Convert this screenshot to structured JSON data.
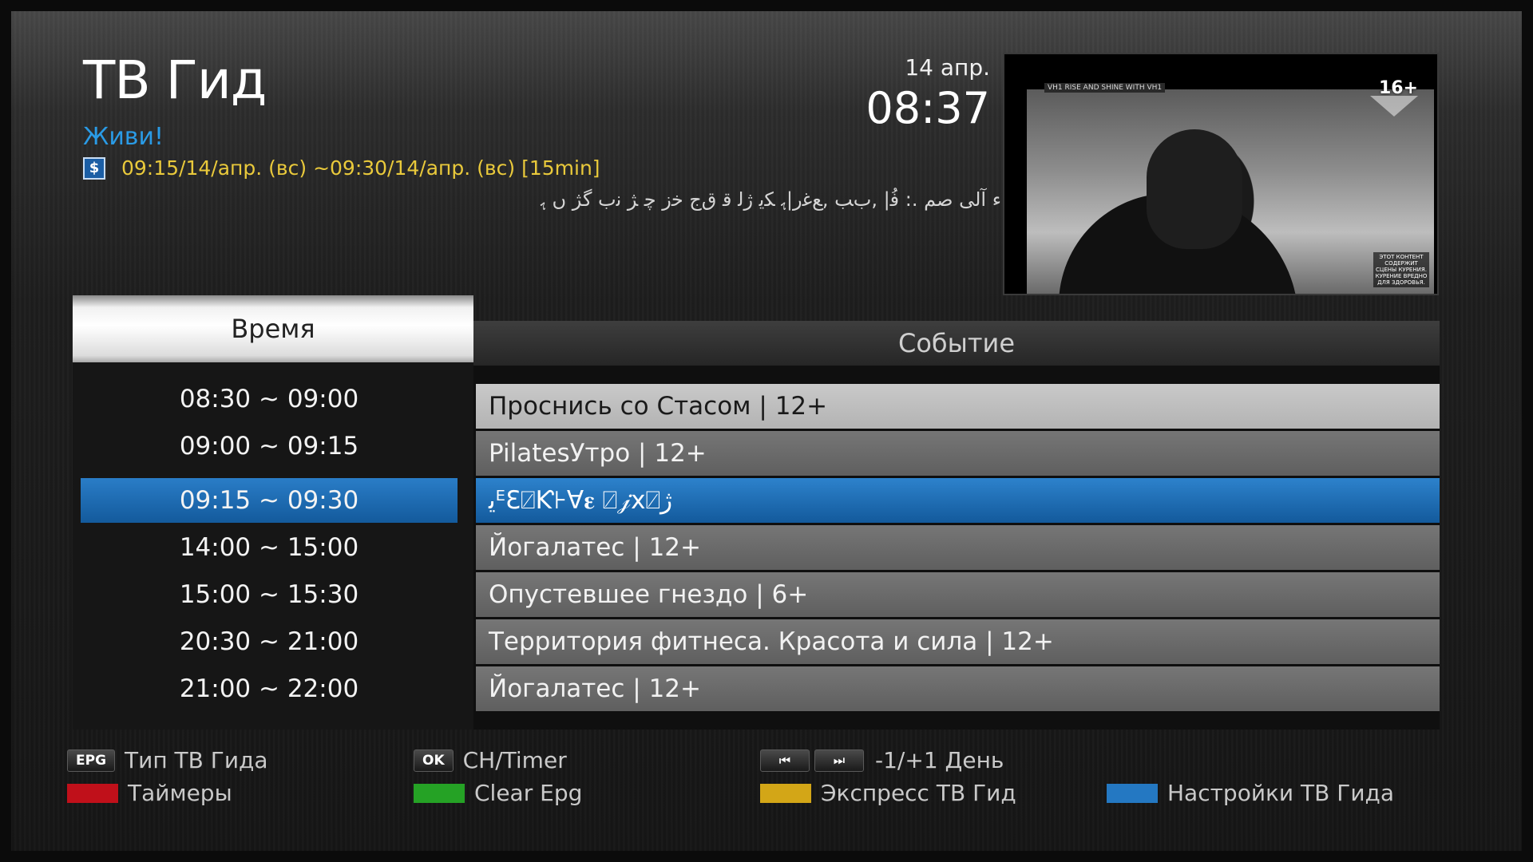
{
  "header": {
    "title": "ТВ Гид",
    "date": "14 апр.",
    "clock": "08:37"
  },
  "current": {
    "channel": "Живи!",
    "time_range": "09:15/14/апр. (вс) ~09:30/14/апр. (вс)  [15min]",
    "description": "ء آلی صم .: ﻓُ| ,ﺏﺐ ,ﻊﻏر|ﮨ ﮑﻳ ﮊﻟ ﻗ ﻕﺝ ﺧﺯ ﭼ ﮋ ﻧﺏ ﮔﮋ ﮞ ﮨ"
  },
  "preview": {
    "age_rating": "16+",
    "channel_bar": "VH1 RISE AND SHINE WITH VH1",
    "warning": "ЭТОТ КОНТЕНТ СОДЕРЖИТ СЦЕНЫ КУРЕНИЯ. КУРЕНИЕ ВРЕДНО ДЛЯ ЗДОРОВЬЯ."
  },
  "columns": {
    "time": "Время",
    "event": "Событие"
  },
  "schedule": [
    {
      "time": "08:30 ~ 09:00",
      "event": "Проснись со Стасом | 12+"
    },
    {
      "time": "09:00 ~ 09:15",
      "event": "PilatesУтро | 12+"
    },
    {
      "time": "09:15 ~ 09:30",
      "event": "ﯾᴱƐ⍁Ƙ⊦Ɐ𝛆 ⍁𝒿ⅹ⍁ﮊ"
    },
    {
      "time": "14:00 ~ 15:00",
      "event": "Йогалатес | 12+"
    },
    {
      "time": "15:00 ~ 15:30",
      "event": "Опустевшее гнездо | 6+"
    },
    {
      "time": "20:30 ~ 21:00",
      "event": "Территория фитнеса. Красота и сила | 12+"
    },
    {
      "time": "21:00 ~ 22:00",
      "event": "Йогалатес | 12+"
    }
  ],
  "legend": {
    "epg_key": "EPG",
    "epg_label": "Тип ТВ Гида",
    "ok_key": "OK",
    "ok_label": "CH/Timer",
    "nav_prev": "⏮",
    "nav_next": "⏭",
    "nav_label": "-1/+1 День",
    "red_label": "Таймеры",
    "green_label": "Clear Epg",
    "yellow_label": "Экспресс ТВ Гид",
    "blue_label": "Настройки ТВ Гида"
  },
  "colors": {
    "accent_blue": "#2a9be6",
    "selection_blue": "#1f6db5",
    "time_yellow": "#e9c93b",
    "key_red": "#c0101a",
    "key_green": "#25a225",
    "key_yellow": "#d3a617",
    "key_blue": "#2478c2"
  }
}
